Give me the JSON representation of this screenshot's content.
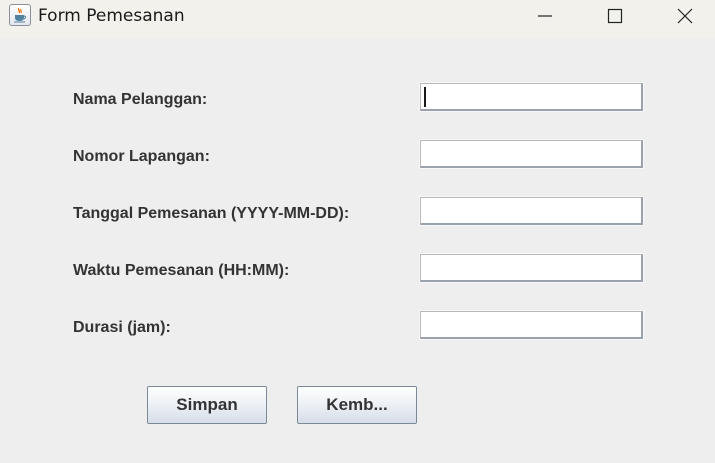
{
  "window": {
    "title": "Form Pemesanan",
    "icon": "java-cup-icon"
  },
  "form": {
    "fields": [
      {
        "label": "Nama Pelanggan:",
        "value": "",
        "focused": true
      },
      {
        "label": "Nomor Lapangan:",
        "value": ""
      },
      {
        "label": "Tanggal Pemesanan (YYYY-MM-DD):",
        "value": ""
      },
      {
        "label": "Waktu Pemesanan (HH:MM):",
        "value": ""
      },
      {
        "label": "Durasi (jam):",
        "value": ""
      }
    ]
  },
  "buttons": {
    "save_label": "Simpan",
    "back_label": "Kemb..."
  }
}
